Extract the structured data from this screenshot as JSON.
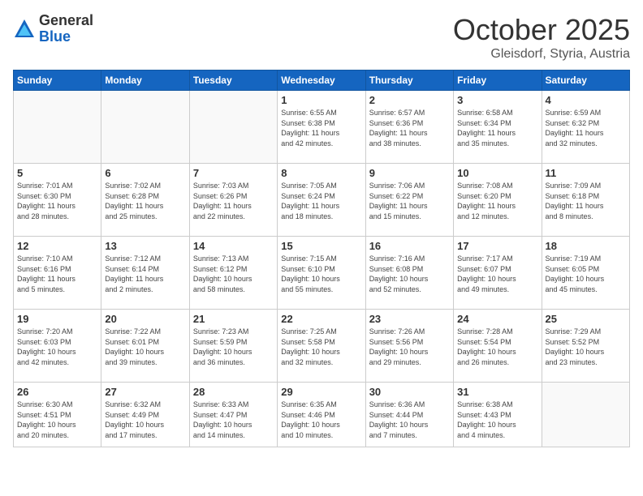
{
  "header": {
    "logo_general": "General",
    "logo_blue": "Blue",
    "month": "October 2025",
    "location": "Gleisdorf, Styria, Austria"
  },
  "weekdays": [
    "Sunday",
    "Monday",
    "Tuesday",
    "Wednesday",
    "Thursday",
    "Friday",
    "Saturday"
  ],
  "weeks": [
    [
      {
        "day": "",
        "info": ""
      },
      {
        "day": "",
        "info": ""
      },
      {
        "day": "",
        "info": ""
      },
      {
        "day": "1",
        "info": "Sunrise: 6:55 AM\nSunset: 6:38 PM\nDaylight: 11 hours\nand 42 minutes."
      },
      {
        "day": "2",
        "info": "Sunrise: 6:57 AM\nSunset: 6:36 PM\nDaylight: 11 hours\nand 38 minutes."
      },
      {
        "day": "3",
        "info": "Sunrise: 6:58 AM\nSunset: 6:34 PM\nDaylight: 11 hours\nand 35 minutes."
      },
      {
        "day": "4",
        "info": "Sunrise: 6:59 AM\nSunset: 6:32 PM\nDaylight: 11 hours\nand 32 minutes."
      }
    ],
    [
      {
        "day": "5",
        "info": "Sunrise: 7:01 AM\nSunset: 6:30 PM\nDaylight: 11 hours\nand 28 minutes."
      },
      {
        "day": "6",
        "info": "Sunrise: 7:02 AM\nSunset: 6:28 PM\nDaylight: 11 hours\nand 25 minutes."
      },
      {
        "day": "7",
        "info": "Sunrise: 7:03 AM\nSunset: 6:26 PM\nDaylight: 11 hours\nand 22 minutes."
      },
      {
        "day": "8",
        "info": "Sunrise: 7:05 AM\nSunset: 6:24 PM\nDaylight: 11 hours\nand 18 minutes."
      },
      {
        "day": "9",
        "info": "Sunrise: 7:06 AM\nSunset: 6:22 PM\nDaylight: 11 hours\nand 15 minutes."
      },
      {
        "day": "10",
        "info": "Sunrise: 7:08 AM\nSunset: 6:20 PM\nDaylight: 11 hours\nand 12 minutes."
      },
      {
        "day": "11",
        "info": "Sunrise: 7:09 AM\nSunset: 6:18 PM\nDaylight: 11 hours\nand 8 minutes."
      }
    ],
    [
      {
        "day": "12",
        "info": "Sunrise: 7:10 AM\nSunset: 6:16 PM\nDaylight: 11 hours\nand 5 minutes."
      },
      {
        "day": "13",
        "info": "Sunrise: 7:12 AM\nSunset: 6:14 PM\nDaylight: 11 hours\nand 2 minutes."
      },
      {
        "day": "14",
        "info": "Sunrise: 7:13 AM\nSunset: 6:12 PM\nDaylight: 10 hours\nand 58 minutes."
      },
      {
        "day": "15",
        "info": "Sunrise: 7:15 AM\nSunset: 6:10 PM\nDaylight: 10 hours\nand 55 minutes."
      },
      {
        "day": "16",
        "info": "Sunrise: 7:16 AM\nSunset: 6:08 PM\nDaylight: 10 hours\nand 52 minutes."
      },
      {
        "day": "17",
        "info": "Sunrise: 7:17 AM\nSunset: 6:07 PM\nDaylight: 10 hours\nand 49 minutes."
      },
      {
        "day": "18",
        "info": "Sunrise: 7:19 AM\nSunset: 6:05 PM\nDaylight: 10 hours\nand 45 minutes."
      }
    ],
    [
      {
        "day": "19",
        "info": "Sunrise: 7:20 AM\nSunset: 6:03 PM\nDaylight: 10 hours\nand 42 minutes."
      },
      {
        "day": "20",
        "info": "Sunrise: 7:22 AM\nSunset: 6:01 PM\nDaylight: 10 hours\nand 39 minutes."
      },
      {
        "day": "21",
        "info": "Sunrise: 7:23 AM\nSunset: 5:59 PM\nDaylight: 10 hours\nand 36 minutes."
      },
      {
        "day": "22",
        "info": "Sunrise: 7:25 AM\nSunset: 5:58 PM\nDaylight: 10 hours\nand 32 minutes."
      },
      {
        "day": "23",
        "info": "Sunrise: 7:26 AM\nSunset: 5:56 PM\nDaylight: 10 hours\nand 29 minutes."
      },
      {
        "day": "24",
        "info": "Sunrise: 7:28 AM\nSunset: 5:54 PM\nDaylight: 10 hours\nand 26 minutes."
      },
      {
        "day": "25",
        "info": "Sunrise: 7:29 AM\nSunset: 5:52 PM\nDaylight: 10 hours\nand 23 minutes."
      }
    ],
    [
      {
        "day": "26",
        "info": "Sunrise: 6:30 AM\nSunset: 4:51 PM\nDaylight: 10 hours\nand 20 minutes."
      },
      {
        "day": "27",
        "info": "Sunrise: 6:32 AM\nSunset: 4:49 PM\nDaylight: 10 hours\nand 17 minutes."
      },
      {
        "day": "28",
        "info": "Sunrise: 6:33 AM\nSunset: 4:47 PM\nDaylight: 10 hours\nand 14 minutes."
      },
      {
        "day": "29",
        "info": "Sunrise: 6:35 AM\nSunset: 4:46 PM\nDaylight: 10 hours\nand 10 minutes."
      },
      {
        "day": "30",
        "info": "Sunrise: 6:36 AM\nSunset: 4:44 PM\nDaylight: 10 hours\nand 7 minutes."
      },
      {
        "day": "31",
        "info": "Sunrise: 6:38 AM\nSunset: 4:43 PM\nDaylight: 10 hours\nand 4 minutes."
      },
      {
        "day": "",
        "info": ""
      }
    ]
  ]
}
